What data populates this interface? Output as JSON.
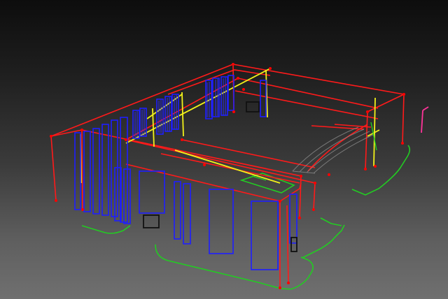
{
  "viewport": {
    "kind": "3d-wireframe-view",
    "background": "gradient-dark-to-gray"
  },
  "colors": {
    "frame": "#ff1a1a",
    "beam": "#f2f21a",
    "panel": "#1e1eff",
    "slab": "#22cc22",
    "door": "#111111",
    "light_column": "#ff3399",
    "node": "#ff0000"
  },
  "layers": [
    "frame-edges",
    "columns",
    "beams",
    "window-panels",
    "slab-outline",
    "doors",
    "canopy"
  ]
}
